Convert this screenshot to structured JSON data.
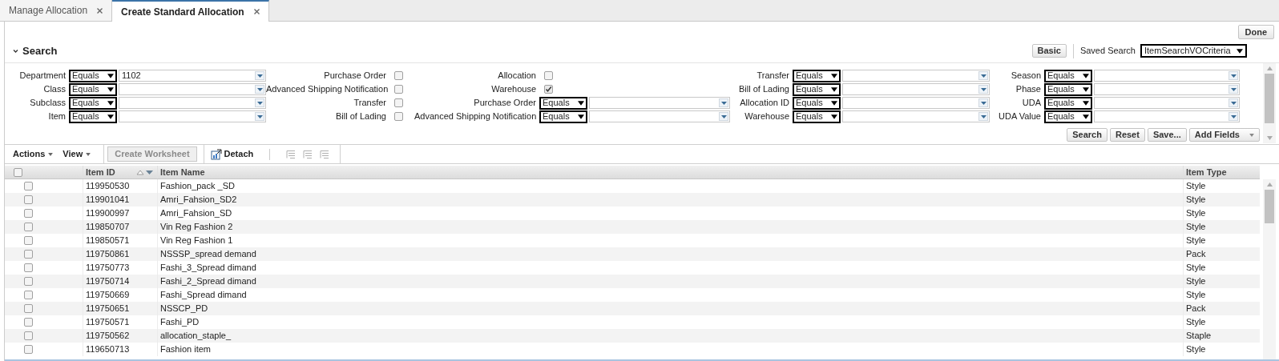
{
  "tabs": [
    {
      "label": "Manage Allocation",
      "selected": false
    },
    {
      "label": "Create Standard Allocation",
      "selected": true
    }
  ],
  "done_button": "Done",
  "search": {
    "title": "Search",
    "expanded": true,
    "basic_button": "Basic",
    "saved_search": {
      "label": "Saved Search",
      "value": "ItemSearchVOCriteria"
    },
    "columns": [
      [
        {
          "kind": "operator",
          "label": "Department",
          "operator": "Equals",
          "value": "1102"
        },
        {
          "kind": "operator",
          "label": "Class",
          "operator": "Equals"
        },
        {
          "kind": "operator",
          "label": "Subclass",
          "operator": "Equals"
        },
        {
          "kind": "operator",
          "label": "Item",
          "operator": "Equals"
        }
      ],
      [
        {
          "kind": "checkbox",
          "label": "Purchase Order",
          "checked": false
        },
        {
          "kind": "checkbox",
          "label": "Advanced Shipping Notification",
          "checked": false
        },
        {
          "kind": "checkbox",
          "label": "Transfer",
          "checked": false
        },
        {
          "kind": "checkbox",
          "label": "Bill of Lading",
          "checked": false
        }
      ],
      [
        {
          "kind": "checkbox",
          "label": "Allocation",
          "checked": false
        },
        {
          "kind": "checkbox",
          "label": "Warehouse",
          "checked": true
        },
        {
          "kind": "operator",
          "label": "Purchase Order",
          "operator": "Equals"
        },
        {
          "kind": "operator",
          "label": "Advanced Shipping Notification",
          "operator": "Equals"
        }
      ],
      [
        {
          "kind": "operator",
          "label": "Transfer",
          "operator": "Equals"
        },
        {
          "kind": "operator",
          "label": "Bill of Lading",
          "operator": "Equals"
        },
        {
          "kind": "operator",
          "label": "Allocation ID",
          "operator": "Equals"
        },
        {
          "kind": "operator",
          "label": "Warehouse",
          "operator": "Equals"
        }
      ],
      [
        {
          "kind": "operator",
          "label": "Season",
          "operator": "Equals"
        },
        {
          "kind": "operator",
          "label": "Phase",
          "operator": "Equals"
        },
        {
          "kind": "operator",
          "label": "UDA",
          "operator": "Equals"
        },
        {
          "kind": "operator",
          "label": "UDA Value",
          "operator": "Equals"
        }
      ]
    ],
    "buttons": [
      "Search",
      "Reset",
      "Save..."
    ],
    "add_fields": "Add Fields"
  },
  "toolbar": {
    "menus": [
      "Actions",
      "View"
    ],
    "create_worksheet": {
      "label": "Create Worksheet",
      "disabled": true
    },
    "detach": "Detach",
    "tree_tools_disabled": true
  },
  "table": {
    "header_checked": false,
    "columns": [
      "Item ID",
      "Item Name",
      "Item Type"
    ],
    "rows": [
      {
        "item_id": "119950530",
        "item_name": "Fashion_pack _SD",
        "item_type": "Style",
        "checked": false
      },
      {
        "item_id": "119901041",
        "item_name": "Amri_Fahsion_SD2",
        "item_type": "Style",
        "checked": false
      },
      {
        "item_id": "119900997",
        "item_name": "Amri_Fahsion_SD",
        "item_type": "Style",
        "checked": false
      },
      {
        "item_id": "119850707",
        "item_name": "Vin Reg Fashion 2",
        "item_type": "Style",
        "checked": false
      },
      {
        "item_id": "119850571",
        "item_name": "Vin Reg Fashion 1",
        "item_type": "Style",
        "checked": false
      },
      {
        "item_id": "119750861",
        "item_name": "NSSSP_spread demand",
        "item_type": "Pack",
        "checked": false
      },
      {
        "item_id": "119750773",
        "item_name": "Fashi_3_Spread dimand",
        "item_type": "Style",
        "checked": false
      },
      {
        "item_id": "119750714",
        "item_name": "Fashi_2_Spread dimand",
        "item_type": "Style",
        "checked": false
      },
      {
        "item_id": "119750669",
        "item_name": "Fashi_Spread dimand",
        "item_type": "Style",
        "checked": false
      },
      {
        "item_id": "119750651",
        "item_name": "NSSCP_PD",
        "item_type": "Pack",
        "checked": false
      },
      {
        "item_id": "119750571",
        "item_name": "Fashi_PD",
        "item_type": "Style",
        "checked": false
      },
      {
        "item_id": "119750562",
        "item_name": "allocation_staple_",
        "item_type": "Staple",
        "checked": false
      },
      {
        "item_id": "119650713",
        "item_name": "Fashion item",
        "item_type": "Style",
        "checked": false
      }
    ]
  }
}
